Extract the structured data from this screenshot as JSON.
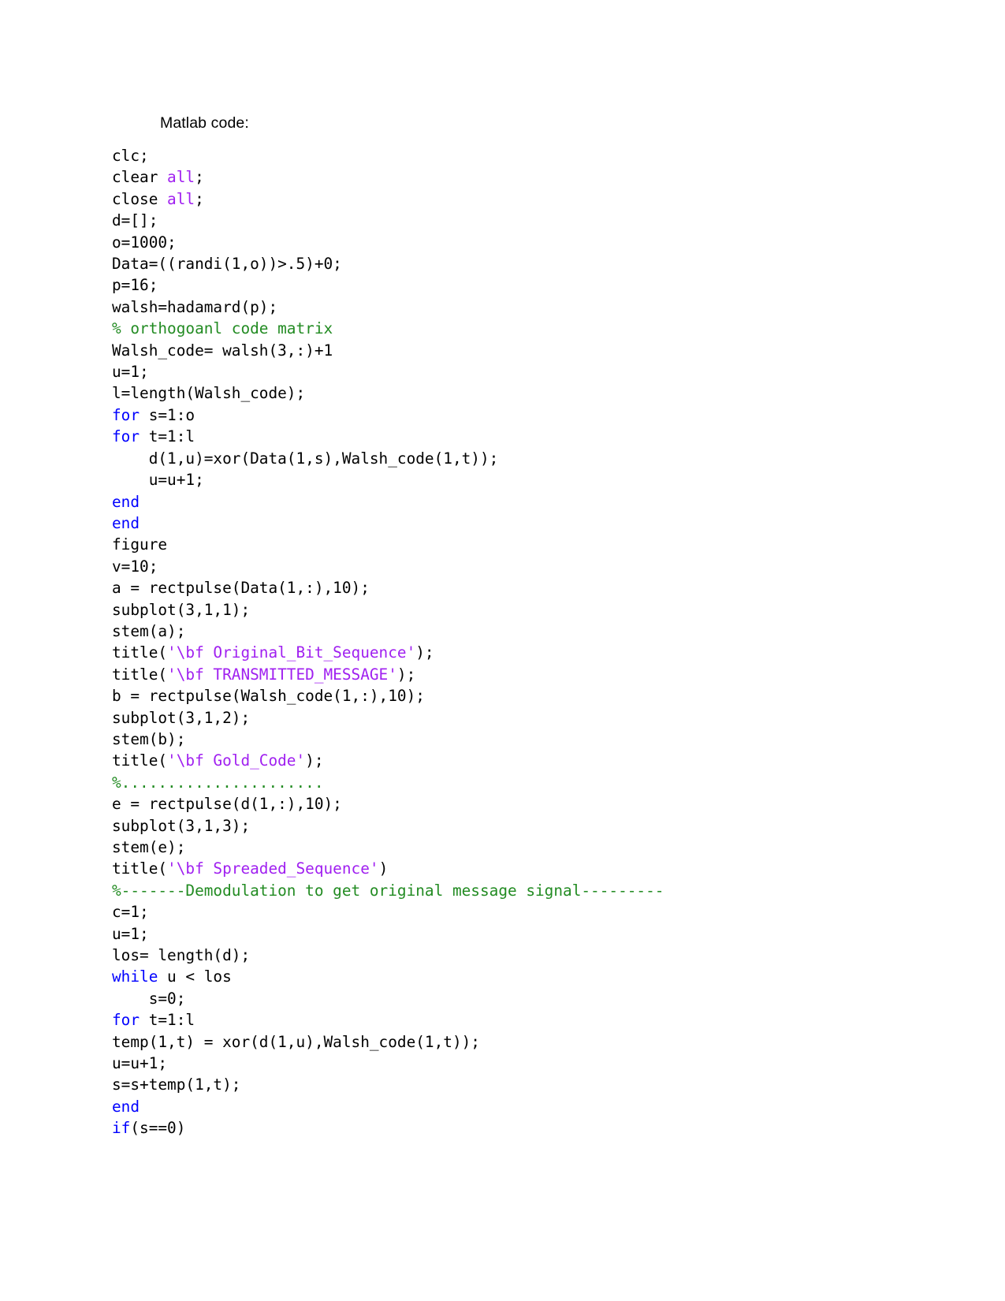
{
  "document": {
    "heading": "Matlab code:",
    "language": "matlab",
    "syntax_colors": {
      "keyword": "#0000ff",
      "comment": "#228b22",
      "string": "#a020f0",
      "plain": "#000000",
      "background": "#ffffff"
    },
    "code_lines": [
      [
        {
          "t": "clc;",
          "c": "pln"
        }
      ],
      [
        {
          "t": "clear ",
          "c": "pln"
        },
        {
          "t": "all",
          "c": "str"
        },
        {
          "t": ";",
          "c": "pln"
        }
      ],
      [
        {
          "t": "close ",
          "c": "pln"
        },
        {
          "t": "all",
          "c": "str"
        },
        {
          "t": ";",
          "c": "pln"
        }
      ],
      [
        {
          "t": "d=[];",
          "c": "pln"
        }
      ],
      [
        {
          "t": "o=1000;",
          "c": "pln"
        }
      ],
      [
        {
          "t": "Data=((randi(1,o))>.5)+0;",
          "c": "pln"
        }
      ],
      [
        {
          "t": "p=16;",
          "c": "pln"
        }
      ],
      [
        {
          "t": "walsh=hadamard(p);",
          "c": "pln"
        }
      ],
      [
        {
          "t": "% orthogoanl code matrix",
          "c": "cmt"
        }
      ],
      [
        {
          "t": "Walsh_code= walsh(3,:)+1",
          "c": "pln"
        }
      ],
      [
        {
          "t": "u=1;",
          "c": "pln"
        }
      ],
      [
        {
          "t": "l=length(Walsh_code);",
          "c": "pln"
        }
      ],
      [
        {
          "t": "for",
          "c": "kw"
        },
        {
          "t": " s=1:o",
          "c": "pln"
        }
      ],
      [
        {
          "t": "for",
          "c": "kw"
        },
        {
          "t": " t=1:l",
          "c": "pln"
        }
      ],
      [
        {
          "t": "    d(1,u)=xor(Data(1,s),Walsh_code(1,t));",
          "c": "pln"
        }
      ],
      [
        {
          "t": "    u=u+1;",
          "c": "pln"
        }
      ],
      [
        {
          "t": "end",
          "c": "kw"
        }
      ],
      [
        {
          "t": "end",
          "c": "kw"
        }
      ],
      [
        {
          "t": "figure",
          "c": "pln"
        }
      ],
      [
        {
          "t": "v=10;",
          "c": "pln"
        }
      ],
      [
        {
          "t": "a = rectpulse(Data(1,:),10);",
          "c": "pln"
        }
      ],
      [
        {
          "t": "subplot(3,1,1);",
          "c": "pln"
        }
      ],
      [
        {
          "t": "stem(a);",
          "c": "pln"
        }
      ],
      [
        {
          "t": "title(",
          "c": "pln"
        },
        {
          "t": "'\\bf Original_Bit_Sequence'",
          "c": "str"
        },
        {
          "t": ");",
          "c": "pln"
        }
      ],
      [
        {
          "t": "title(",
          "c": "pln"
        },
        {
          "t": "'\\bf TRANSMITTED_MESSAGE'",
          "c": "str"
        },
        {
          "t": ");",
          "c": "pln"
        }
      ],
      [
        {
          "t": "b = rectpulse(Walsh_code(1,:),10);",
          "c": "pln"
        }
      ],
      [
        {
          "t": "subplot(3,1,2);",
          "c": "pln"
        }
      ],
      [
        {
          "t": "stem(b);",
          "c": "pln"
        }
      ],
      [
        {
          "t": "title(",
          "c": "pln"
        },
        {
          "t": "'\\bf Gold_Code'",
          "c": "str"
        },
        {
          "t": ");",
          "c": "pln"
        }
      ],
      [
        {
          "t": "%......................",
          "c": "cmt"
        }
      ],
      [
        {
          "t": "e = rectpulse(d(1,:),10);",
          "c": "pln"
        }
      ],
      [
        {
          "t": "subplot(3,1,3);",
          "c": "pln"
        }
      ],
      [
        {
          "t": "stem(e);",
          "c": "pln"
        }
      ],
      [
        {
          "t": "title(",
          "c": "pln"
        },
        {
          "t": "'\\bf Spreaded_Sequence'",
          "c": "str"
        },
        {
          "t": ")",
          "c": "pln"
        }
      ],
      [
        {
          "t": "%-------Demodulation to get original message signal---------",
          "c": "cmt"
        }
      ],
      [
        {
          "t": "c=1;",
          "c": "pln"
        }
      ],
      [
        {
          "t": "u=1;",
          "c": "pln"
        }
      ],
      [
        {
          "t": "los= length(d);",
          "c": "pln"
        }
      ],
      [
        {
          "t": "while",
          "c": "kw"
        },
        {
          "t": " u < los",
          "c": "pln"
        }
      ],
      [
        {
          "t": "    s=0;",
          "c": "pln"
        }
      ],
      [
        {
          "t": "for",
          "c": "kw"
        },
        {
          "t": " t=1:l",
          "c": "pln"
        }
      ],
      [
        {
          "t": "temp(1,t) = xor(d(1,u),Walsh_code(1,t));",
          "c": "pln"
        }
      ],
      [
        {
          "t": "u=u+1;",
          "c": "pln"
        }
      ],
      [
        {
          "t": "s=s+temp(1,t);",
          "c": "pln"
        }
      ],
      [
        {
          "t": "end",
          "c": "kw"
        }
      ],
      [
        {
          "t": "if",
          "c": "kw"
        },
        {
          "t": "(s==0)",
          "c": "pln"
        }
      ]
    ]
  }
}
